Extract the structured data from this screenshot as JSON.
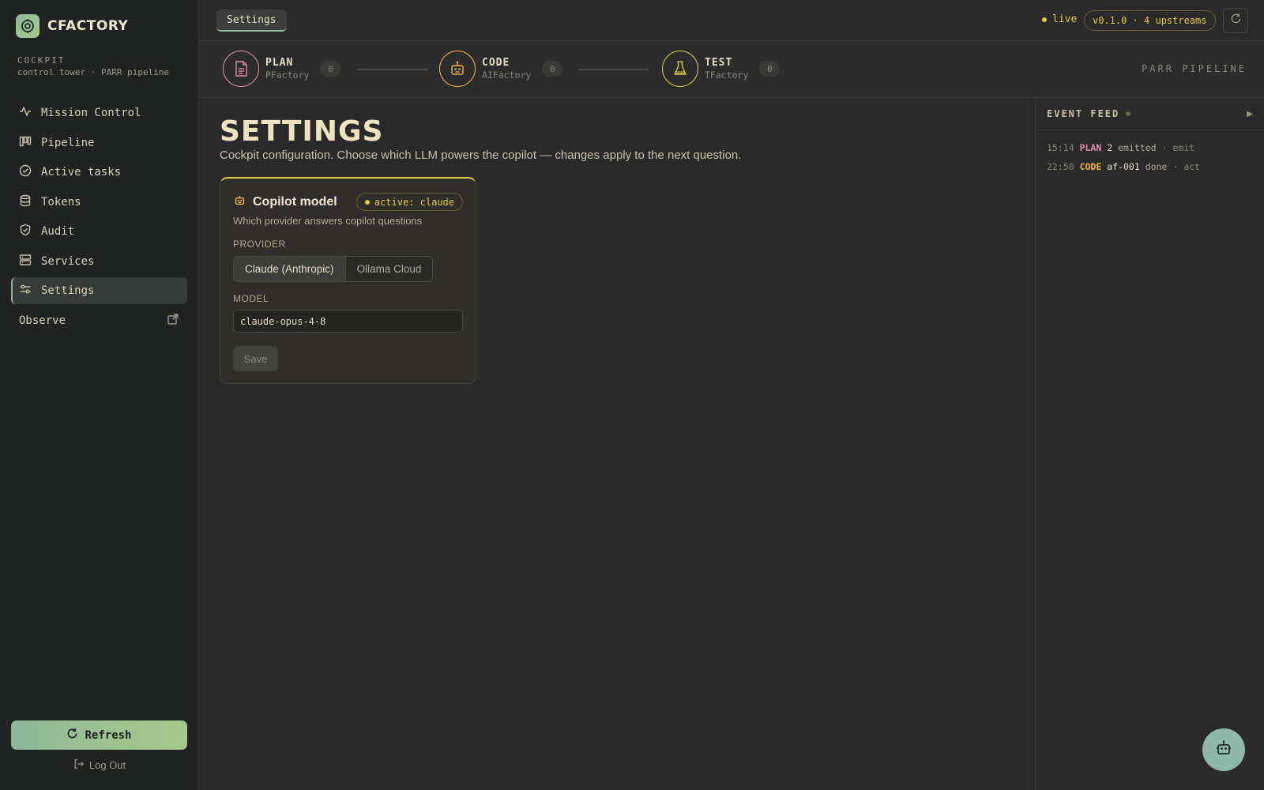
{
  "app": {
    "name": "CFACTORY"
  },
  "cockpit": {
    "label": "COCKPIT",
    "subtitle": "control tower · PARR pipeline"
  },
  "sidebar": {
    "items": [
      {
        "label": "Mission Control",
        "icon": "activity-icon"
      },
      {
        "label": "Pipeline",
        "icon": "kanban-icon"
      },
      {
        "label": "Active tasks",
        "icon": "check-circle-icon"
      },
      {
        "label": "Tokens",
        "icon": "database-icon"
      },
      {
        "label": "Audit",
        "icon": "shield-check-icon"
      },
      {
        "label": "Services",
        "icon": "server-icon"
      },
      {
        "label": "Settings",
        "icon": "sliders-icon",
        "active": true
      }
    ],
    "observe_label": "Observe",
    "refresh_label": "Refresh",
    "logout_label": "Log Out"
  },
  "topbar": {
    "breadcrumb": "Settings",
    "live_label": "live",
    "version": "v0.1.0 · 4 upstreams"
  },
  "pipeline": {
    "label": "PARR PIPELINE",
    "stages": [
      {
        "name": "PLAN",
        "factory": "PFactory",
        "count": "0",
        "color": "#e08aa8"
      },
      {
        "name": "CODE",
        "factory": "AIFactory",
        "count": "0",
        "color": "#f0b44a"
      },
      {
        "name": "TEST",
        "factory": "TFactory",
        "count": "0",
        "color": "#d8c84a"
      }
    ]
  },
  "main": {
    "title": "SETTINGS",
    "description": "Cockpit configuration. Choose which LLM powers the copilot — changes apply to the next question."
  },
  "copilot_card": {
    "title": "Copilot model",
    "badge": "active: claude",
    "subtitle": "Which provider answers copilot questions",
    "provider_label": "PROVIDER",
    "providers": [
      "Claude (Anthropic)",
      "Ollama Cloud"
    ],
    "selected_provider": "Claude (Anthropic)",
    "model_label": "MODEL",
    "model_value": "claude-opus-4-8",
    "save_label": "Save"
  },
  "feed": {
    "title": "EVENT FEED",
    "toggle": "▶",
    "events": [
      {
        "time": "15:14",
        "stage": "PLAN",
        "ref": "2",
        "message": "emitted",
        "kind": "emit"
      },
      {
        "time": "22:50",
        "stage": "CODE",
        "ref": "af-001",
        "message": "done",
        "kind": "act"
      }
    ]
  },
  "colors": {
    "accent": "#8fb89a",
    "live": "#e4c84a",
    "plan": "#e08aa8",
    "code": "#f0b44a",
    "test": "#d8c84a"
  }
}
